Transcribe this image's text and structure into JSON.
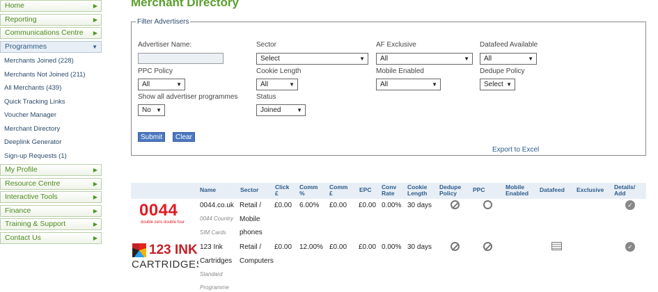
{
  "sidebar": {
    "top_before": [
      "Home",
      "Reporting",
      "Communications Centre"
    ],
    "programmes": {
      "label": "Programmes",
      "items": [
        "Merchants Joined (228)",
        "Merchants Not Joined (211)",
        "All Merchants (439)",
        "Quick Tracking Links",
        "Voucher Manager",
        "Merchant Directory",
        "Deeplink Generator",
        "Sign-up Requests (1)"
      ]
    },
    "top_after": [
      "My Profile",
      "Resource Centre",
      "Interactive Tools",
      "Finance",
      "Training & Support",
      "Contact Us"
    ]
  },
  "page": {
    "title": "Merchant Directory"
  },
  "filter": {
    "legend": "Filter Advertisers",
    "advertiser_name_label": "Advertiser Name:",
    "sector_label": "Sector",
    "sector_value": "Select",
    "af_exclusive_label": "AF Exclusive",
    "af_exclusive_value": "All",
    "datafeed_label": "Datafeed Available",
    "datafeed_value": "All",
    "ppc_label": "PPC Policy",
    "ppc_value": "All",
    "cookie_label": "Cookie Length",
    "cookie_value": "All",
    "mobile_label": "Mobile Enabled",
    "mobile_value": "All",
    "dedupe_label": "Dedupe Policy",
    "dedupe_value": "Select",
    "show_all_label": "Show all advertiser programmes",
    "show_all_value": "No",
    "status_label": "Status",
    "status_value": "Joined",
    "submit": "Submit",
    "clear": "Clear",
    "export": "Export to Excel"
  },
  "table": {
    "headers": {
      "name": "Name",
      "sector": "Sector",
      "click": [
        "Click",
        "£"
      ],
      "comm_pct": [
        "Comm",
        "%"
      ],
      "comm_gbp": [
        "Comm",
        "£"
      ],
      "epc": "EPC",
      "conv": [
        "Conv",
        "Rate"
      ],
      "cookie": [
        "Cookie",
        "Length"
      ],
      "dedupe": [
        "Dedupe",
        "Policy"
      ],
      "ppc": "PPC",
      "mobile": [
        "Mobile",
        "Enabled"
      ],
      "datafeed": "Datafeed",
      "exclusive": "Exclusive",
      "details": [
        "Details/",
        "Add"
      ]
    },
    "rows": [
      {
        "logo_text": "0044",
        "logo_tagline": "double zero double four",
        "name": "0044.co.uk",
        "sub1": "0044 Country",
        "sub2": "SIM Cards",
        "sector": [
          "Retail /",
          "Mobile",
          "phones"
        ],
        "click": "£0.00",
        "comm_pct": "6.00%",
        "comm_gbp": "£0.00",
        "epc": "£0.00",
        "conv": "0.00%",
        "cookie": "30 days"
      },
      {
        "logo_text_a": "123",
        "logo_text_b": "INK",
        "logo_text_c": "CARTRIDGES",
        "name": "123 Ink",
        "name2": "Cartridges",
        "sub1": "Standard",
        "sub2": "Programme",
        "sector": [
          "Retail /",
          "Computers"
        ],
        "click": "£0.00",
        "comm_pct": "12.00%",
        "comm_gbp": "£0.00",
        "epc": "£0.00",
        "conv": "0.00%",
        "cookie": "30 days"
      }
    ]
  },
  "icons": {
    "dedupe": "no-entry-icon",
    "ppc": "circle-icon",
    "datafeed": "datafeed-icon",
    "details": "check-icon"
  }
}
